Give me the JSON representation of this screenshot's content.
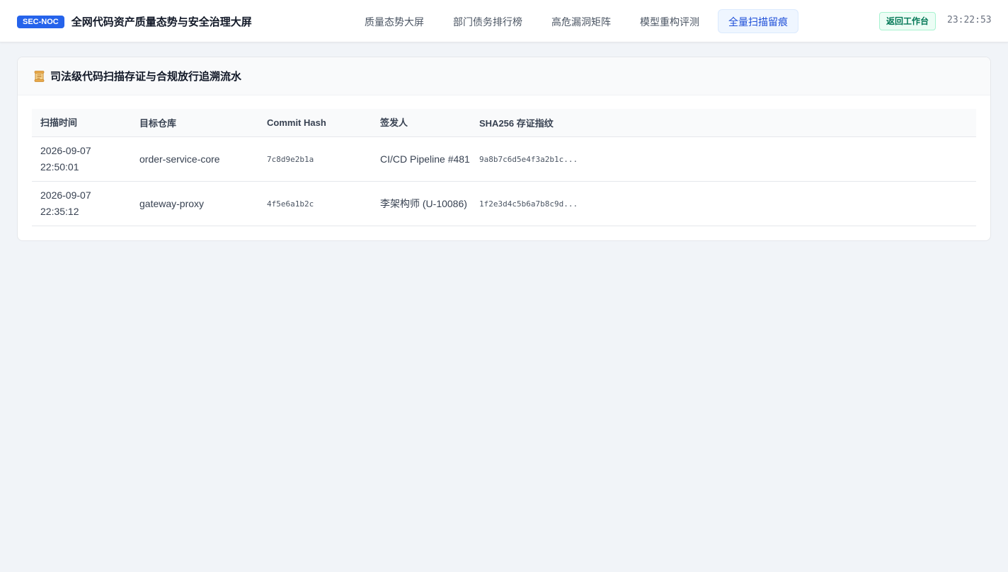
{
  "header": {
    "badge": "SEC-NOC",
    "title": "全网代码资产质量态势与安全治理大屏",
    "tabs": [
      {
        "label": "质量态势大屏",
        "active": false
      },
      {
        "label": "部门债务排行榜",
        "active": false
      },
      {
        "label": "高危漏洞矩阵",
        "active": false
      },
      {
        "label": "模型重构评测",
        "active": false
      },
      {
        "label": "全量扫描留痕",
        "active": true
      }
    ],
    "back_label": "返回工作台",
    "clock": "23:22:53"
  },
  "panel": {
    "icon": "scroll-icon",
    "title": "司法级代码扫描存证与合规放行追溯流水"
  },
  "table": {
    "columns": [
      "扫描时间",
      "目标仓库",
      "Commit Hash",
      "签发人",
      "SHA256 存证指纹"
    ],
    "rows": [
      {
        "time_date": "2026-09-07",
        "time_clock": "22:50:01",
        "repo": "order-service-core",
        "commit": "7c8d9e2b1a",
        "signer": "CI/CD Pipeline #481",
        "sha": "9a8b7c6d5e4f3a2b1c..."
      },
      {
        "time_date": "2026-09-07",
        "time_clock": "22:35:12",
        "repo": "gateway-proxy",
        "commit": "4f5e6a1b2c",
        "signer": "李架构师 (U-10086)",
        "sha": "1f2e3d4c5b6a7b8c9d..."
      }
    ]
  },
  "colors": {
    "accent": "#2563eb",
    "active_tab_bg": "#eff6ff",
    "back_button": "#047857",
    "page_bg": "#f1f4f8"
  }
}
